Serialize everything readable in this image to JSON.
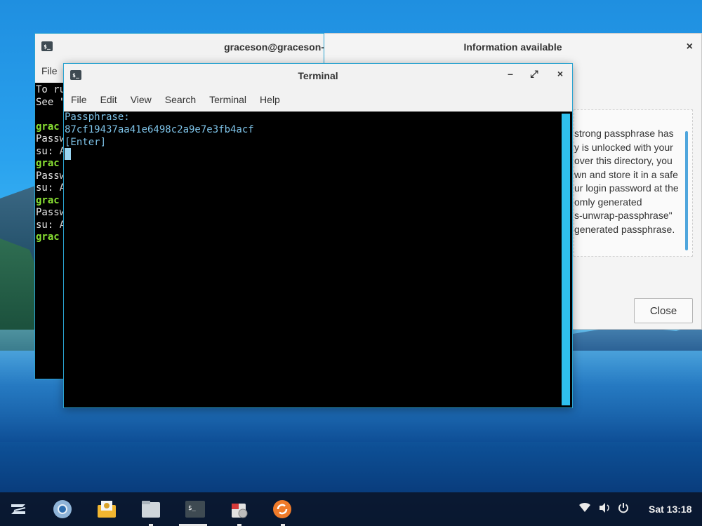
{
  "info_dialog": {
    "title": "Information available",
    "close_x": "×",
    "text_lines": [
      "strong passphrase has",
      "y is unlocked with your",
      "over this directory, you",
      "wn and store it in a safe",
      "ur login password at the",
      "omly generated",
      "s-unwrap-passphrase\"",
      "generated passphrase."
    ],
    "close_button": "Close"
  },
  "back_terminal": {
    "title": "graceson@graceson-",
    "menu_file": "File",
    "lines": [
      {
        "text": "To ru",
        "color": "white"
      },
      {
        "text": "See \"",
        "color": "white"
      },
      {
        "text": "",
        "color": "white"
      },
      {
        "text": "grac",
        "color": "green"
      },
      {
        "text": "Passw",
        "color": "white"
      },
      {
        "text": "su: A",
        "color": "white"
      },
      {
        "text": "grac",
        "color": "green"
      },
      {
        "text": "Passw",
        "color": "white"
      },
      {
        "text": "su: A",
        "color": "white"
      },
      {
        "text": "grac",
        "color": "green"
      },
      {
        "text": "Passw",
        "color": "white"
      },
      {
        "text": "su: A",
        "color": "white"
      },
      {
        "text": "grac",
        "color": "green"
      }
    ]
  },
  "front_terminal": {
    "title": "Terminal",
    "controls": {
      "minimize": "–",
      "maximize": "⤢",
      "close": "×"
    },
    "menu": [
      "File",
      "Edit",
      "View",
      "Search",
      "Terminal",
      "Help"
    ],
    "lines": [
      "Passphrase:",
      "87cf19437aa41e6498c2a9e7e3fb4acf",
      "[Enter]"
    ]
  },
  "taskbar": {
    "clock": "Sat 13:18",
    "icons": [
      "zorin-menu-icon",
      "chromium-icon",
      "mail-icon",
      "files-icon",
      "terminal-icon",
      "software-icon",
      "updates-icon"
    ],
    "tray": [
      "wifi-icon",
      "volume-icon",
      "power-icon"
    ]
  },
  "colors": {
    "accent": "#2aa3d0",
    "terminal_text": "#7ec3e8",
    "prompt_green": "#8ae234"
  }
}
